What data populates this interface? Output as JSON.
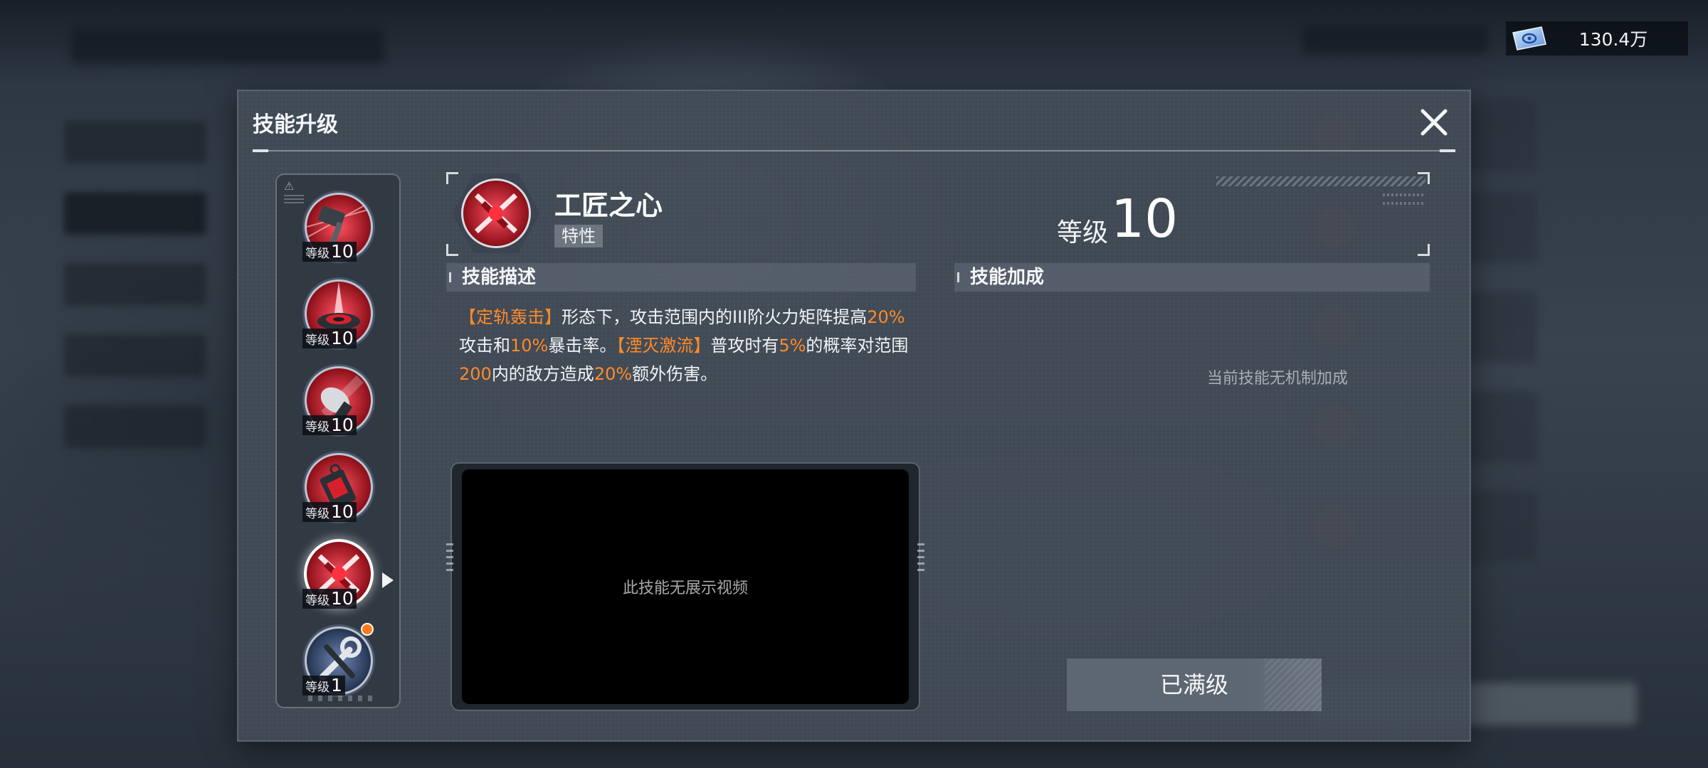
{
  "currency": {
    "icon": "ticket-icon",
    "value": "130.4万"
  },
  "dialog": {
    "title": "技能升级",
    "close_icon": "close-icon"
  },
  "skill_list": [
    {
      "name": "hammer-skill",
      "level_label": "等级",
      "level": "10"
    },
    {
      "name": "drone-skill",
      "level_label": "等级",
      "level": "10"
    },
    {
      "name": "shell-skill",
      "level_label": "等级",
      "level": "10"
    },
    {
      "name": "device-skill",
      "level_label": "等级",
      "level": "10"
    },
    {
      "name": "craftsman-skill",
      "level_label": "等级",
      "level": "10",
      "selected": true
    },
    {
      "name": "wrench-skill",
      "level_label": "等级",
      "level": "1",
      "notification": true
    }
  ],
  "selected_skill": {
    "name": "工匠之心",
    "tag": "特性",
    "level_label": "等级",
    "level": "10"
  },
  "description": {
    "header": "技能描述",
    "segments": [
      {
        "text": "【定轨轰击】",
        "hl": true
      },
      {
        "text": "形态下，攻击范围内的III阶火力矩阵提高",
        "hl": false
      },
      {
        "text": "20%",
        "hl": true
      },
      {
        "text": "攻击和",
        "hl": false
      },
      {
        "text": "10%",
        "hl": true
      },
      {
        "text": "暴击率。",
        "hl": false
      },
      {
        "text": "【湮灭激流】",
        "hl": true
      },
      {
        "text": "普攻时有",
        "hl": false
      },
      {
        "text": "5%",
        "hl": true
      },
      {
        "text": "的概率对范围",
        "hl": false
      },
      {
        "text": "200",
        "hl": true
      },
      {
        "text": "内的敌方造成",
        "hl": false
      },
      {
        "text": "20%",
        "hl": true
      },
      {
        "text": "额外伤害。",
        "hl": false
      }
    ]
  },
  "bonus": {
    "header": "技能加成",
    "empty_text": "当前技能无机制加成"
  },
  "video": {
    "empty_text": "此技能无展示视频"
  },
  "action": {
    "label": "已满级"
  },
  "colors": {
    "highlight": "#ff8a2a",
    "notification": "#ff7a1a",
    "skill_red": "#c41e2a"
  }
}
